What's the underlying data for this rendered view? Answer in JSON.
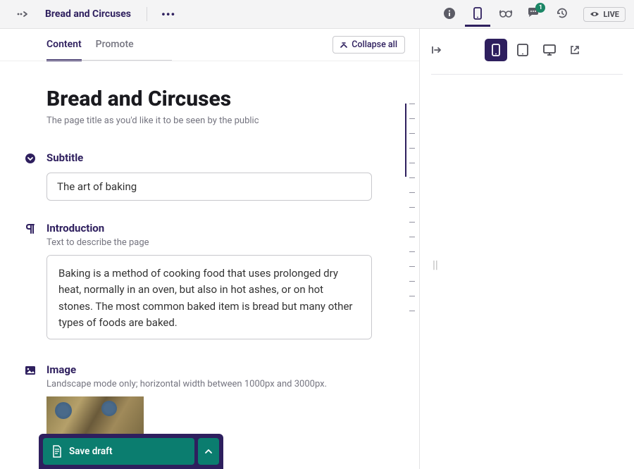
{
  "header": {
    "page_title": "Bread and Circuses",
    "more": "•••",
    "comment_count": "1",
    "live_label": "LIVE"
  },
  "tabs": {
    "content": "Content",
    "promote": "Promote",
    "collapse_all": "Collapse all"
  },
  "title_section": {
    "title": "Bread and Circuses",
    "help": "The page title as you'd like it to be seen by the public"
  },
  "subtitle": {
    "label": "Subtitle",
    "value": "The art of baking"
  },
  "introduction": {
    "label": "Introduction",
    "help": "Text to describe the page",
    "value": "Baking is a method of cooking food that uses prolonged dry heat, normally in an oven, but also in hot ashes, or on hot stones. The most common baked item is bread but many other types of foods are baked."
  },
  "image": {
    "label": "Image",
    "help": "Landscape mode only; horizontal width between 1000px and 3000px."
  },
  "footer": {
    "save_label": "Save draft"
  },
  "preview": {
    "placeholder": "||"
  }
}
